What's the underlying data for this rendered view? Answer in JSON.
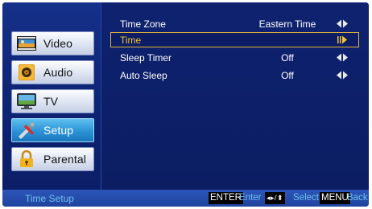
{
  "sidebar": {
    "items": [
      {
        "label": "Video",
        "icon": "video-icon",
        "active": false
      },
      {
        "label": "Audio",
        "icon": "audio-icon",
        "active": false
      },
      {
        "label": "TV",
        "icon": "tv-icon",
        "active": false
      },
      {
        "label": "Setup",
        "icon": "setup-icon",
        "active": true
      },
      {
        "label": "Parental",
        "icon": "lock-icon",
        "active": false
      }
    ]
  },
  "settings": {
    "rows": [
      {
        "label": "Time Zone",
        "value": "Eastern Time",
        "selected": false
      },
      {
        "label": "Time",
        "value": "",
        "selected": true
      },
      {
        "label": "Sleep Timer",
        "value": "Off",
        "selected": false
      },
      {
        "label": "Auto Sleep",
        "value": "Off",
        "selected": false
      }
    ]
  },
  "status_bar": {
    "title": "Time Setup",
    "enter_key": "ENTER",
    "enter_action": "Enter",
    "select_key": "◂▸/⬍",
    "select_action": "Select",
    "menu_key": "MENU",
    "menu_action": "Back"
  },
  "colors": {
    "background": "#0d1f6a",
    "accent_selected": "#e7b637",
    "status_text": "#6fc0ef",
    "active_nav": "#2b93d6"
  }
}
